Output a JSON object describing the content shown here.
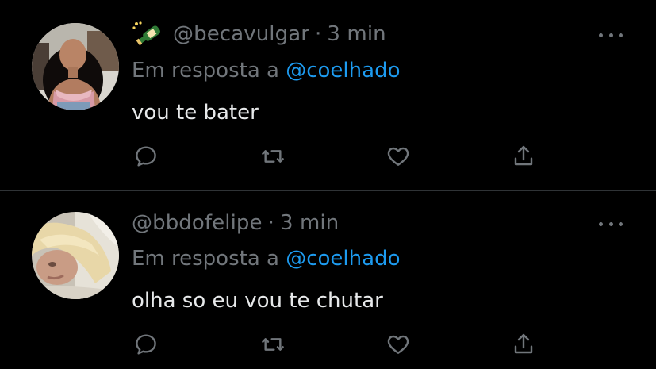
{
  "tweets": [
    {
      "emoji": "champagne-bottle",
      "handle": "@becavulgar",
      "separator": "·",
      "time": "3 min",
      "reply_prefix": "Em resposta a",
      "reply_to": "@coelhado",
      "text": "vou te bater"
    },
    {
      "handle": "@bbdofelipe",
      "separator": "·",
      "time": "3 min",
      "reply_prefix": "Em resposta a",
      "reply_to": "@coelhado",
      "text": "olha so eu vou te chutar"
    }
  ],
  "icons": {
    "more": "more-horizontal-icon",
    "reply": "comment-icon",
    "retweet": "retweet-icon",
    "like": "heart-icon",
    "share": "share-icon"
  },
  "colors": {
    "background": "#000000",
    "secondary_text": "#71767b",
    "primary_text": "#e7e9ea",
    "mention": "#1d9bf0",
    "divider": "#2f3336"
  }
}
